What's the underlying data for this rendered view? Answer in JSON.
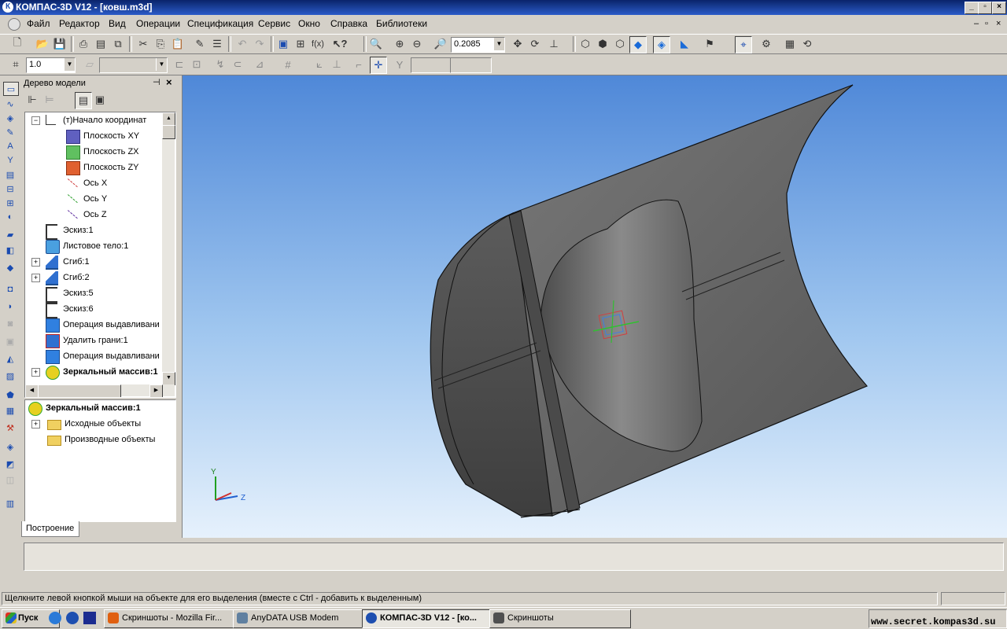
{
  "window": {
    "title": "КОМПАС-3D V12 - [ковш.m3d]",
    "app_icon": "К"
  },
  "menu": {
    "items": [
      "Файл",
      "Редактор",
      "Вид",
      "Операции",
      "Спецификация",
      "Сервис",
      "Окно",
      "Справка",
      "Библиотеки"
    ]
  },
  "toolbar": {
    "zoom_value": "0.2085",
    "step_value": "1.0"
  },
  "tree_panel": {
    "title": "Дерево модели",
    "tab_label": "Построение",
    "items": [
      {
        "label": "(т)Начало координат",
        "icon": "origin-icon",
        "indent": 0,
        "expander": "−"
      },
      {
        "label": "Плоскость XY",
        "icon": "plane-xy-icon",
        "indent": 1,
        "expander": ""
      },
      {
        "label": "Плоскость ZX",
        "icon": "plane-zx-icon",
        "indent": 1,
        "expander": ""
      },
      {
        "label": "Плоскость ZY",
        "icon": "plane-zy-icon",
        "indent": 1,
        "expander": ""
      },
      {
        "label": "Ось X",
        "icon": "axis-x-icon",
        "indent": 1,
        "expander": ""
      },
      {
        "label": "Ось Y",
        "icon": "axis-y-icon",
        "indent": 1,
        "expander": ""
      },
      {
        "label": "Ось Z",
        "icon": "axis-z-icon",
        "indent": 1,
        "expander": ""
      },
      {
        "label": "Эскиз:1",
        "icon": "sketch-icon",
        "indent": 0,
        "expander": ""
      },
      {
        "label": "Листовое тело:1",
        "icon": "sheet-body-icon",
        "indent": 0,
        "expander": ""
      },
      {
        "label": "Сгиб:1",
        "icon": "bend-icon",
        "indent": 0,
        "expander": "+"
      },
      {
        "label": "Сгиб:2",
        "icon": "bend-icon",
        "indent": 0,
        "expander": "+"
      },
      {
        "label": "Эскиз:5",
        "icon": "sketch-icon",
        "indent": 0,
        "expander": ""
      },
      {
        "label": "Эскиз:6",
        "icon": "sketch-icon",
        "indent": 0,
        "expander": ""
      },
      {
        "label": "Операция выдавливани",
        "icon": "extrude-icon",
        "indent": 0,
        "expander": ""
      },
      {
        "label": "Удалить грани:1",
        "icon": "delete-faces-icon",
        "indent": 0,
        "expander": ""
      },
      {
        "label": "Операция выдавливани",
        "icon": "extrude-icon",
        "indent": 0,
        "expander": ""
      },
      {
        "label": "Зеркальный массив:1",
        "icon": "mirror-array-icon",
        "indent": 0,
        "expander": "+",
        "bold": true
      }
    ],
    "detail": {
      "header": "Зеркальный массив:1",
      "items": [
        "Исходные объекты",
        "Производные объекты"
      ]
    }
  },
  "viewport": {
    "triad_labels": {
      "y": "Y",
      "z": "Z"
    }
  },
  "status": {
    "hint": "Щелкните левой кнопкой мыши на объекте для его выделения (вместе с Ctrl - добавить к выделенным)"
  },
  "taskbar": {
    "start_label": "Пуск",
    "tasks": [
      {
        "label": "Скриншоты - Mozilla Fir...",
        "active": false,
        "color": "#e06010"
      },
      {
        "label": "AnyDATA USB Modem",
        "active": false,
        "color": "#6080a0"
      },
      {
        "label": "КОМПАС-3D V12 - [ко...",
        "active": true,
        "color": "#1e4fb0"
      },
      {
        "label": "Скриншоты",
        "active": false,
        "color": "#505050"
      }
    ],
    "watermark": "www.secret.kompas3d.su"
  },
  "colors": {
    "title_bar": "#0a246a",
    "model_gray": "#6e6e6e",
    "viewport_top": "#4f88d8"
  }
}
